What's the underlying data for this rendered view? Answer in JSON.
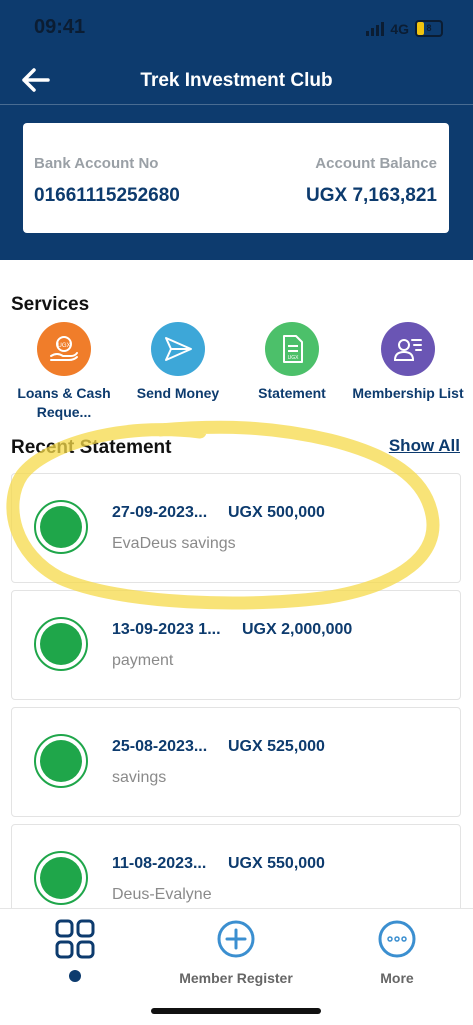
{
  "status": {
    "time": "09:41",
    "network": "4G",
    "battery": "8"
  },
  "header": {
    "title": "Trek Investment Club"
  },
  "account": {
    "bank_label": "Bank Account No",
    "bank_number": "01661115252680",
    "balance_label": "Account Balance",
    "balance_value": "UGX 7,163,821"
  },
  "services": {
    "title": "Services",
    "items": [
      {
        "label": "Loans & Cash Reque...",
        "icon": "loan-hand-icon",
        "color": "#f07d2a"
      },
      {
        "label": "Send Money",
        "icon": "paper-plane-icon",
        "color": "#3da7d8"
      },
      {
        "label": "Statement",
        "icon": "document-icon",
        "color": "#4cc06a"
      },
      {
        "label": "Membership List",
        "icon": "member-list-icon",
        "color": "#6a55b4"
      }
    ]
  },
  "recent": {
    "title": "Recent Statement",
    "show_all": "Show All",
    "items": [
      {
        "date": "27-09-2023...",
        "amount": "UGX 500,000",
        "desc": "EvaDeus savings"
      },
      {
        "date": "13-09-2023 1...",
        "amount": "UGX 2,000,000",
        "desc": "payment"
      },
      {
        "date": "25-08-2023...",
        "amount": "UGX 525,000",
        "desc": "savings"
      },
      {
        "date": "11-08-2023...",
        "amount": "UGX 550,000",
        "desc": "Deus-Evalyne"
      }
    ]
  },
  "tabs": [
    {
      "label": "",
      "icon": "grid-icon"
    },
    {
      "label": "Member Register",
      "icon": "plus-circle-icon"
    },
    {
      "label": "More",
      "icon": "more-circle-icon"
    }
  ],
  "colors": {
    "primary": "#0d3b6e",
    "success": "#1fa64a",
    "highlight": "#f5d949"
  }
}
